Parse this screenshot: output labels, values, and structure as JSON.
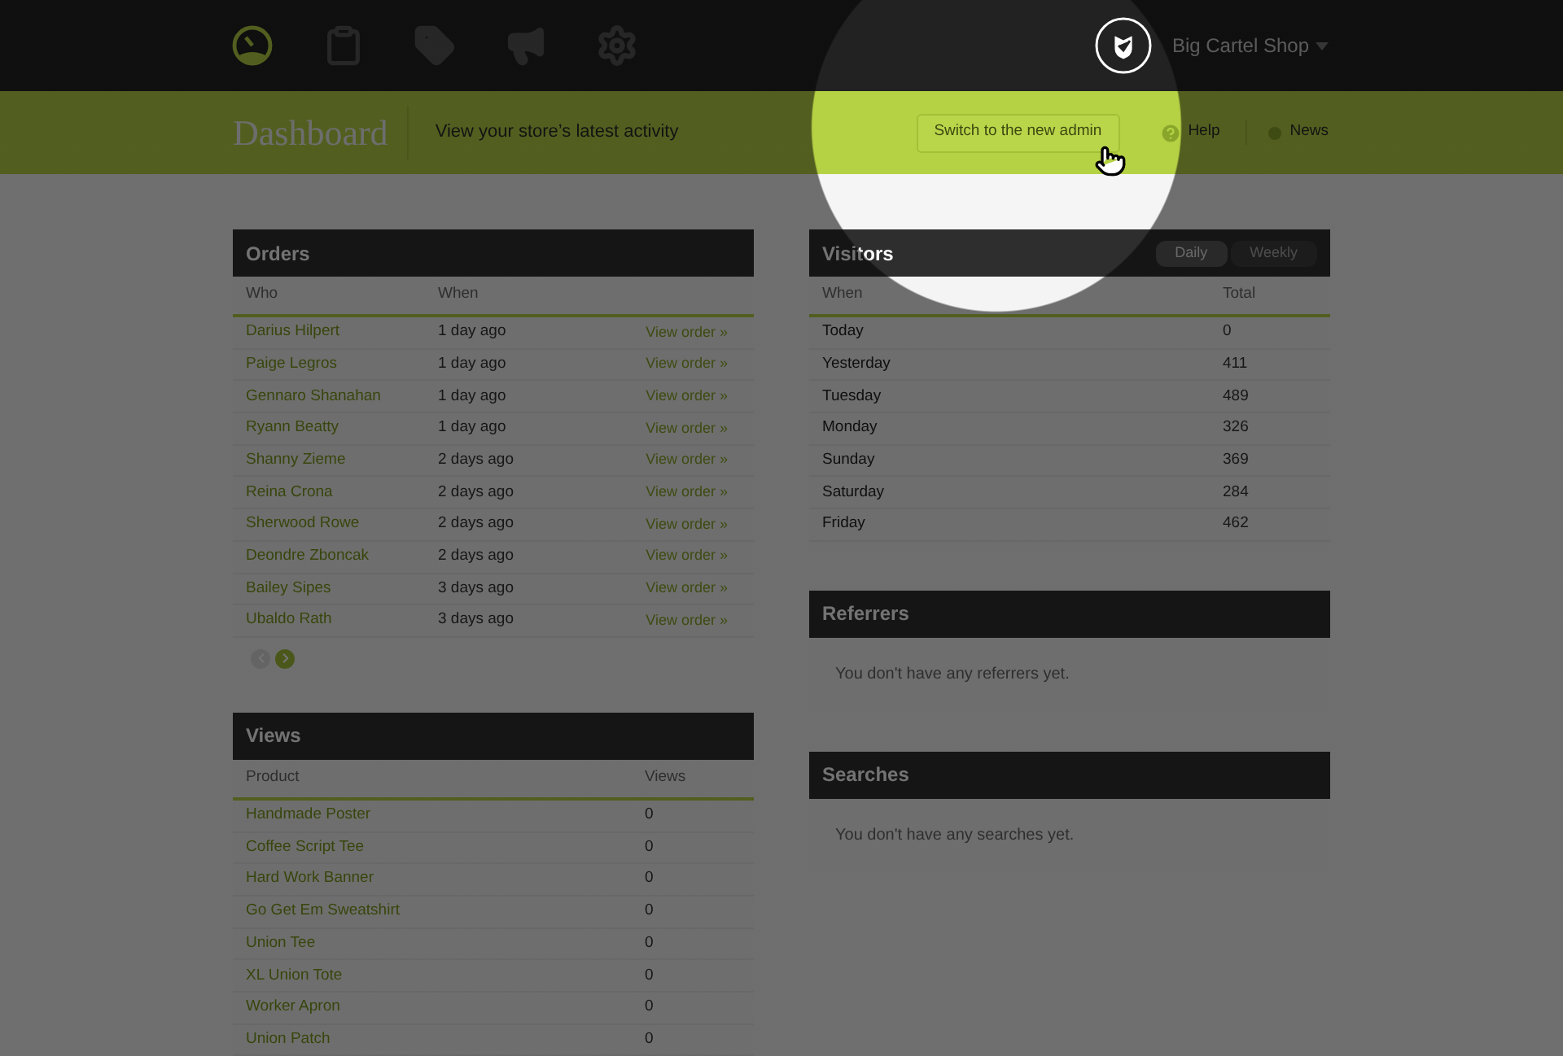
{
  "nav": {
    "icons": [
      {
        "kind": "dashboard",
        "selected": true
      },
      {
        "kind": "orders",
        "selected": false
      },
      {
        "kind": "products",
        "selected": false
      },
      {
        "kind": "promote",
        "selected": false
      },
      {
        "kind": "settings",
        "selected": false
      }
    ],
    "shop_menu": "Big Cartel Shop"
  },
  "header": {
    "title": "Dashboard",
    "subtitle": "View your store’s latest activity",
    "switch_button": "Switch to the new admin",
    "links": [
      {
        "kind": "help",
        "label": "Help"
      },
      {
        "kind": "news",
        "label": "News"
      }
    ]
  },
  "orders": {
    "title": "Orders",
    "columns": [
      "Who",
      "When"
    ],
    "rows": [
      {
        "who": "Darius Hilpert",
        "when": "1 day ago",
        "action": "View order »"
      },
      {
        "who": "Paige Legros",
        "when": "1 day ago",
        "action": "View order »"
      },
      {
        "who": "Gennaro Shanahan",
        "when": "1 day ago",
        "action": "View order »"
      },
      {
        "who": "Ryann Beatty",
        "when": "1 day ago",
        "action": "View order »"
      },
      {
        "who": "Shanny Zieme",
        "when": "2 days ago",
        "action": "View order »"
      },
      {
        "who": "Reina Crona",
        "when": "2 days ago",
        "action": "View order »"
      },
      {
        "who": "Sherwood Rowe",
        "when": "2 days ago",
        "action": "View order »"
      },
      {
        "who": "Deondre Zboncak",
        "when": "2 days ago",
        "action": "View order »"
      },
      {
        "who": "Bailey Sipes",
        "when": "3 days ago",
        "action": "View order »"
      },
      {
        "who": "Ubaldo Rath",
        "when": "3 days ago",
        "action": "View order »"
      }
    ],
    "pagination": [
      {
        "kind": "prev",
        "disabled": true
      },
      {
        "kind": "next",
        "disabled": false
      }
    ]
  },
  "views": {
    "title": "Views",
    "columns": [
      "Product",
      "Views"
    ],
    "rows": [
      {
        "product": "Handmade Poster",
        "views": "0"
      },
      {
        "product": "Coffee Script Tee",
        "views": "0"
      },
      {
        "product": "Hard Work Banner",
        "views": "0"
      },
      {
        "product": "Go Get Em Sweatshirt",
        "views": "0"
      },
      {
        "product": "Union Tee",
        "views": "0"
      },
      {
        "product": "XL Union Tote",
        "views": "0"
      },
      {
        "product": "Worker Apron",
        "views": "0"
      },
      {
        "product": "Union Patch",
        "views": "0"
      }
    ]
  },
  "visitors": {
    "title": "Visitors",
    "tabs": [
      {
        "label": "Daily",
        "selected": true
      },
      {
        "label": "Weekly",
        "selected": false
      }
    ],
    "columns": [
      "When",
      "Total"
    ],
    "rows": [
      {
        "when": "Today",
        "total": "0"
      },
      {
        "when": "Yesterday",
        "total": "411"
      },
      {
        "when": "Tuesday",
        "total": "489"
      },
      {
        "when": "Monday",
        "total": "326"
      },
      {
        "when": "Sunday",
        "total": "369"
      },
      {
        "when": "Saturday",
        "total": "284"
      },
      {
        "when": "Friday",
        "total": "462"
      }
    ]
  },
  "referrers": {
    "title": "Referrers",
    "message": "You don't have any referrers yet."
  },
  "searches": {
    "title": "Searches",
    "message": "You don't have any searches yet."
  },
  "spotlight": {
    "visible": true
  }
}
